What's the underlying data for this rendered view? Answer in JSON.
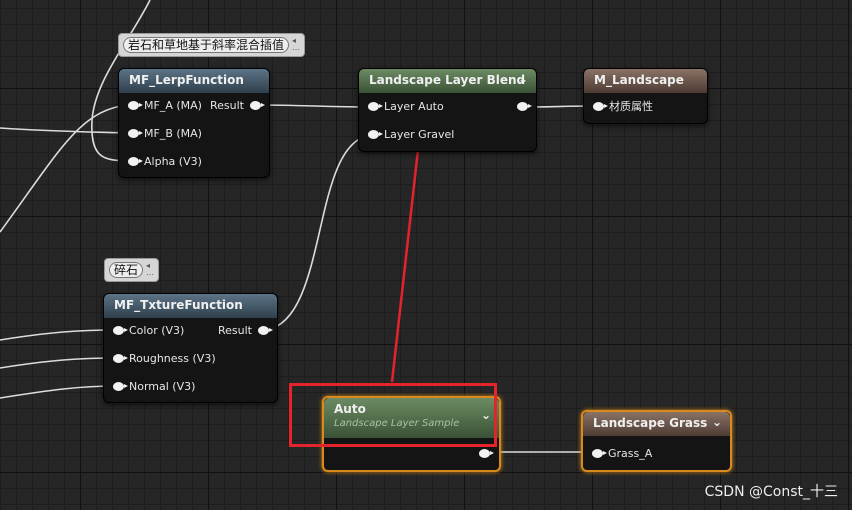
{
  "comments": {
    "rock_grass": "岩石和草地基于斜率混合插值",
    "gravel": "碎石"
  },
  "nodes": {
    "lerp": {
      "title": "MF_LerpFunction",
      "inputs": [
        "MF_A (MA)",
        "MF_B (MA)",
        "Alpha (V3)"
      ],
      "output": "Result"
    },
    "texture": {
      "title": "MF_TxtureFunction",
      "inputs": [
        "Color (V3)",
        "Roughness (V3)",
        "Normal (V3)"
      ],
      "output": "Result"
    },
    "blend": {
      "title": "Landscape Layer Blend",
      "inputs": [
        "Layer Auto",
        "Layer Gravel"
      ],
      "chevron": "⌄"
    },
    "material": {
      "title": "M_Landscape",
      "inputs": [
        "材质属性"
      ]
    },
    "auto": {
      "title": "Auto",
      "subtitle": "Landscape Layer Sample",
      "chevron": "⌄"
    },
    "grass": {
      "title": "Landscape Grass",
      "inputs": [
        "Grass_A"
      ],
      "chevron": "⌄"
    }
  },
  "colors": {
    "selection": "#d88a1c",
    "highlight": "#e5232b",
    "arrow": "#e5232b"
  },
  "watermark": "CSDN @Const_十三"
}
